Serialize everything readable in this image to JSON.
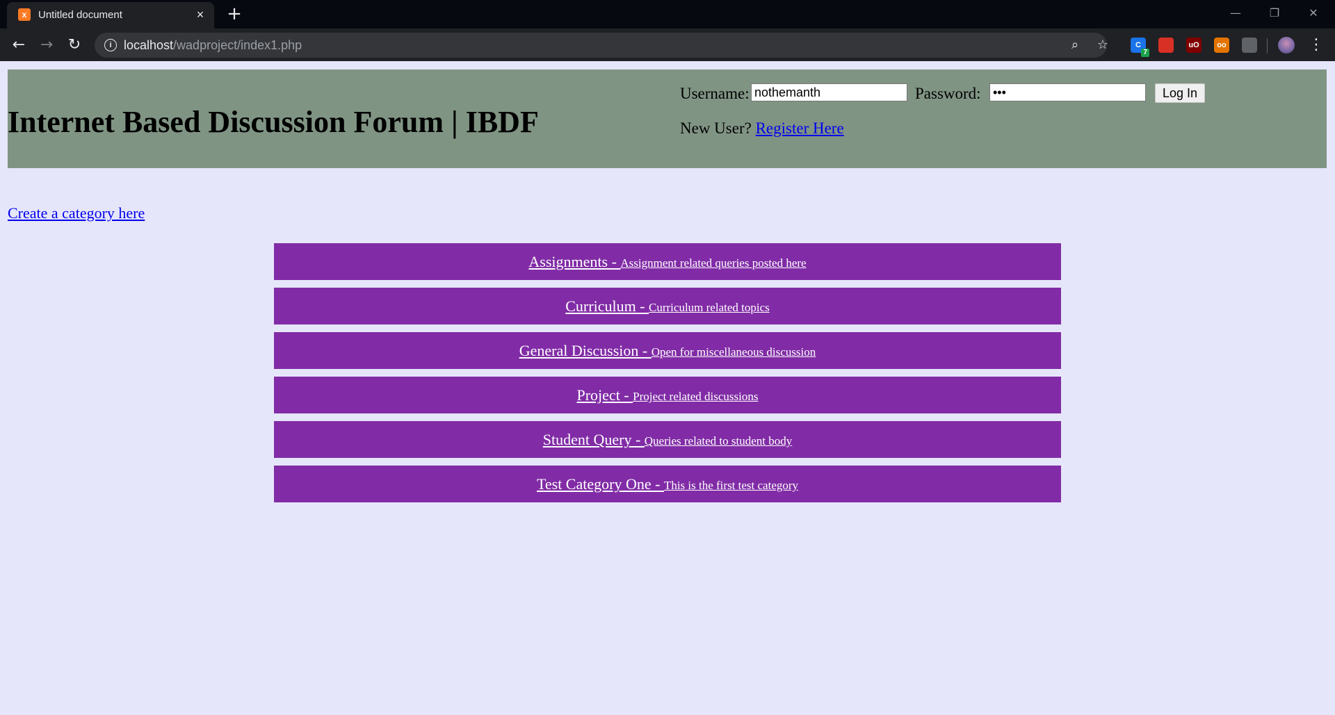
{
  "browser": {
    "tab_title": "Untitled document",
    "favicon_text": "x",
    "url_host": "localhost",
    "url_path": "/wadproject/index1.php",
    "extensions": [
      {
        "name": "extension-c",
        "label": "C",
        "badge": "7",
        "color": "#1a73e8"
      },
      {
        "name": "extension-book",
        "label": "",
        "color": "#d93025"
      },
      {
        "name": "extension-ublock",
        "label": "uO",
        "color": "#800000"
      },
      {
        "name": "extension-eyes",
        "label": "oo",
        "color": "#e37400"
      },
      {
        "name": "extension-gauge",
        "label": "",
        "color": "#5f6368"
      }
    ]
  },
  "header": {
    "site_title": "Internet Based Discussion Forum | IBDF",
    "username_label": "Username:",
    "username_value": "nothemanth",
    "password_label": "Password:",
    "password_value": "•••",
    "login_button": "Log In",
    "new_user_text": "New User?",
    "register_link": "Register Here"
  },
  "main": {
    "create_category_link": "Create a category here",
    "categories": [
      {
        "name": "Assignments - ",
        "description": "Assignment related queries posted here"
      },
      {
        "name": "Curriculum - ",
        "description": "Curriculum related topics"
      },
      {
        "name": "General Discussion - ",
        "description": "Open for miscellaneous discussion"
      },
      {
        "name": "Project - ",
        "description": "Project related discussions"
      },
      {
        "name": "Student Query - ",
        "description": "Queries related to student body"
      },
      {
        "name": "Test Category One - ",
        "description": "This is the first test category"
      }
    ]
  },
  "colors": {
    "page_background": "#e6e6fa",
    "header_background": "#809484",
    "category_background": "#812ca6",
    "link": "#0000ee"
  }
}
